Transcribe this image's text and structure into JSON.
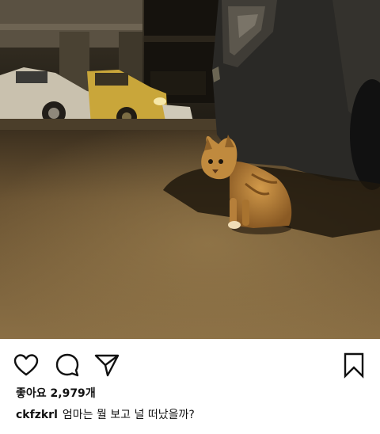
{
  "post": {
    "image_alt": "",
    "likes": {
      "label": "좋아요",
      "count": "2,979",
      "suffix": "개"
    },
    "caption": {
      "username": "ckfzkrl",
      "text": "엄마는 뭘 보고 널 떠났을까?"
    }
  },
  "actions": {
    "like_icon": "heart-icon",
    "comment_icon": "comment-icon",
    "share_icon": "send-icon",
    "save_icon": "bookmark-icon"
  }
}
